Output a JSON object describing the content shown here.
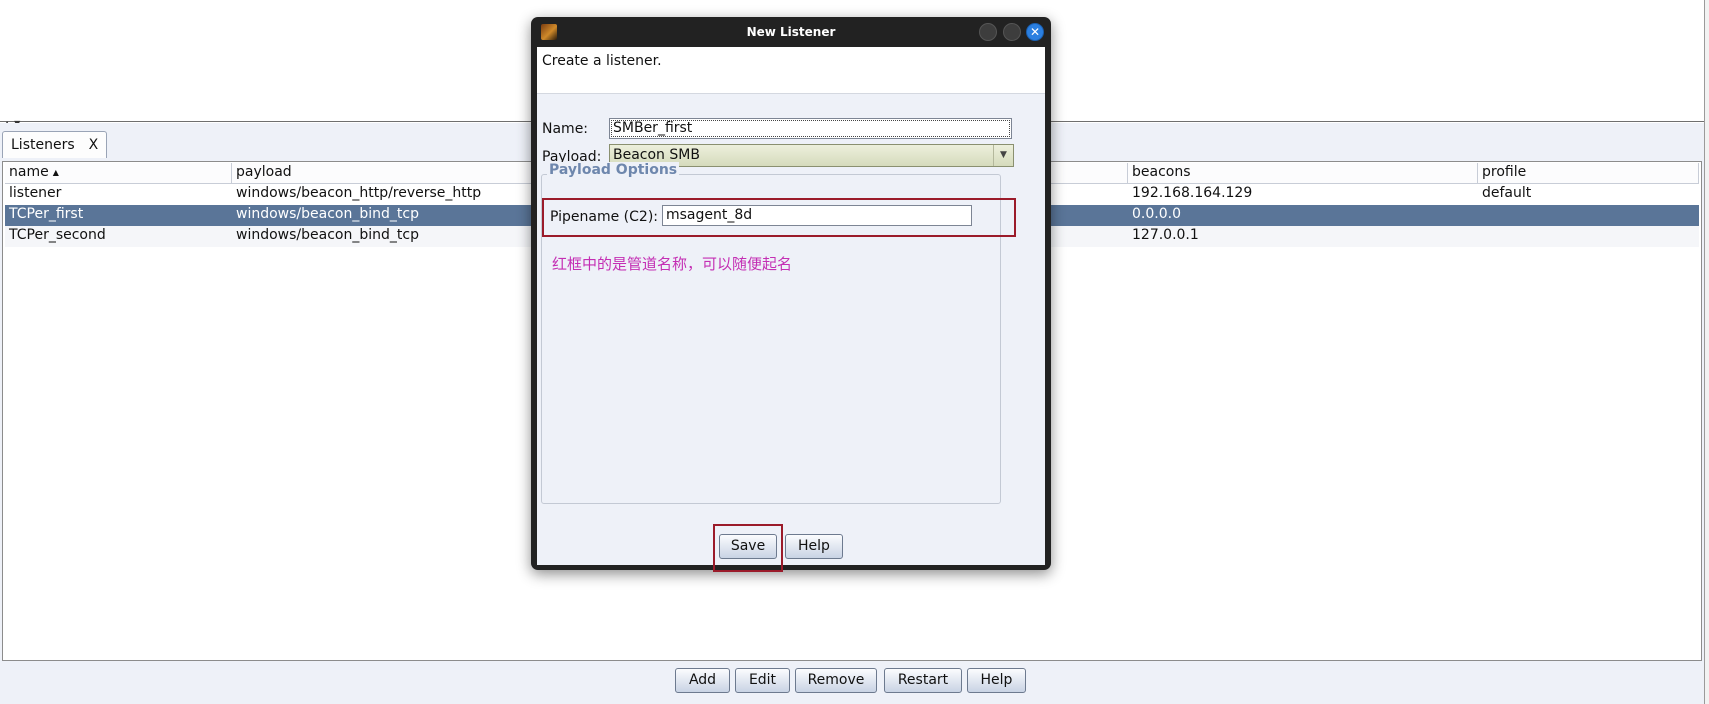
{
  "listeners_tab": {
    "label": "Listeners",
    "close": "X"
  },
  "table": {
    "columns": [
      "name",
      "payload",
      "beacons",
      "profile"
    ],
    "sort_indicator": "▲",
    "rows": [
      {
        "name": "listener",
        "payload": "windows/beacon_http/reverse_http",
        "beacons": "192.168.164.129",
        "profile": "default"
      },
      {
        "name": "TCPer_first",
        "payload": "windows/beacon_bind_tcp",
        "beacons": "0.0.0.0",
        "profile": ""
      },
      {
        "name": "TCPer_second",
        "payload": "windows/beacon_bind_tcp",
        "beacons": "127.0.0.1",
        "profile": ""
      }
    ],
    "selected_row": 1
  },
  "bottom_buttons": {
    "add": "Add",
    "edit": "Edit",
    "remove": "Remove",
    "restart": "Restart",
    "help": "Help"
  },
  "dialog": {
    "title": "New Listener",
    "close_glyph": "✕",
    "description": "Create a listener.",
    "name_label": "Name:",
    "name_value": "SMBer_first",
    "payload_label": "Payload:",
    "payload_value": "Beacon SMB",
    "payload_options_title": "Payload Options",
    "pipename_label": "Pipename (C2):",
    "pipename_value": "msagent_8d",
    "annotation": "红框中的是管道名称，可以随便起名",
    "save_label": "Save",
    "help_label": "Help"
  },
  "colors": {
    "selection": "#5a7598",
    "annotation": "#c42fb4",
    "highlight_box": "#9b1b2a",
    "group_title": "#6e87ad"
  }
}
